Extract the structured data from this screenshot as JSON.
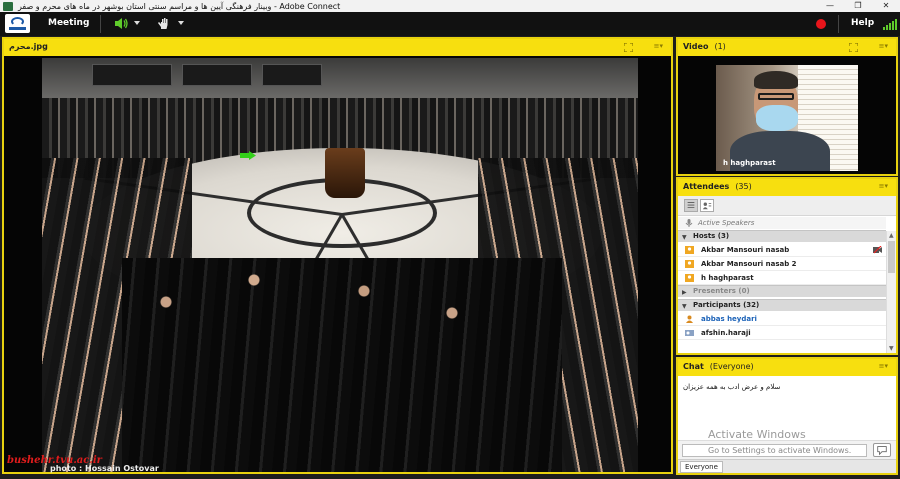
{
  "window": {
    "title": "وبینار فرهنگی آیین ها و مراسم سنتی استان بوشهر در ماه های محرم و صفر - Adobe Connect",
    "controls": [
      "—",
      "❐",
      "✕"
    ]
  },
  "menubar": {
    "meeting_label": "Meeting",
    "help_label": "Help",
    "recording_color": "#e8151b",
    "signal_color": "#5fcb2b"
  },
  "share_pod": {
    "title": "محرم.jpg",
    "border_color": "#e8d20f",
    "watermark": "bushehr.tvu.ac.ir",
    "photo_credit": "photo : Hossain Ostovar"
  },
  "video_pod": {
    "title": "Video",
    "count": "(1)",
    "camera_name": "h haghparast"
  },
  "attendees_pod": {
    "title": "Attendees",
    "count": "(35)",
    "active_speakers_label": "Active Speakers",
    "hosts_label": "Hosts (3)",
    "hosts": [
      {
        "name": "Akbar Mansouri nasab"
      },
      {
        "name": "Akbar Mansouri nasab 2"
      },
      {
        "name": "h haghparast"
      }
    ],
    "presenters_label": "Presenters (0)",
    "participants_label": "Participants (32)",
    "participants": [
      {
        "name": "abbas heydari"
      },
      {
        "name": "afshin.haraji"
      }
    ]
  },
  "chat_pod": {
    "title": "Chat",
    "scope": "(Everyone)",
    "messages": [
      {
        "text": "سلام و عرض ادب به همه عزیزان"
      }
    ],
    "input_placeholder": "Go to Settings to activate Windows.",
    "activate_windows": "Activate Windows",
    "tab_everyone": "Everyone"
  }
}
